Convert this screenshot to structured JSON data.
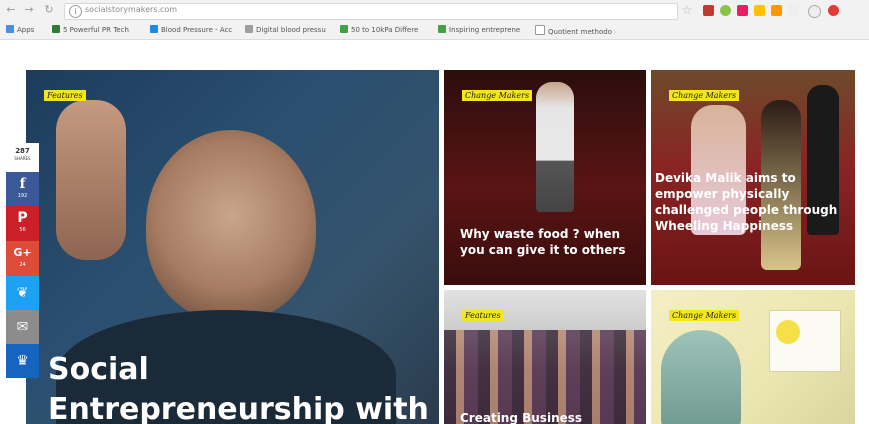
{
  "browser": {
    "url": "socialstorymakers.com",
    "bookmarks": [
      "Apps",
      "5 Powerful PR Tech",
      "Blood Pressure - Acc",
      "Digital blood pressu",
      "50 to 10kPa Differe",
      "Inspiring entreprene",
      "Quotient methodo"
    ]
  },
  "share": {
    "total_count": "287",
    "total_label": "SHARES",
    "facebook": {
      "glyph": "f",
      "count": "192"
    },
    "pinterest": {
      "glyph": "P",
      "count": "56"
    },
    "googleplus": {
      "glyph": "G+",
      "count": "24"
    },
    "twitter": {
      "glyph": "❦"
    },
    "email": {
      "glyph": "✉"
    },
    "sumo": {
      "glyph": "♛"
    }
  },
  "tiles": {
    "main": {
      "tag": "Features",
      "title_line1": "Social",
      "title_line2": "Entrepreneurship with"
    },
    "food": {
      "tag": "Change Makers",
      "title": "Why waste food ? when you can give it to others"
    },
    "devika": {
      "tag": "Change Makers",
      "title": "Devika Malik aims to empower physically challenged people through Wheeling Happiness"
    },
    "business": {
      "tag": "Features",
      "title": "Creating Business"
    },
    "hijab": {
      "tag": "Change Makers"
    }
  },
  "colors": {
    "tag_yellow": "#f4e61c",
    "facebook": "#3b5998",
    "pinterest": "#cb2027",
    "googleplus": "#dd4b39",
    "twitter": "#1da1f2",
    "email": "#8c8c8c",
    "sumo": "#1565c0"
  }
}
